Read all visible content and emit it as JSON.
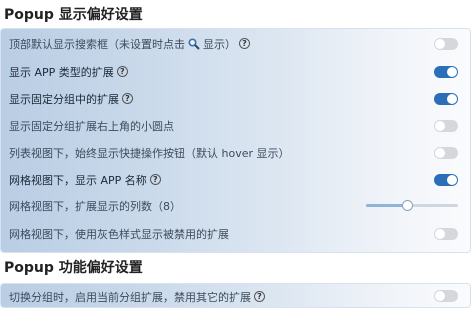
{
  "sections": [
    {
      "title": "Popup 显示偏好设置"
    },
    {
      "title": "Popup 功能偏好设置"
    }
  ],
  "display_prefs": [
    {
      "label": "顶部默认显示搜索框（未设置时点击",
      "label_after": "显示）",
      "icon": "search-icon",
      "help": true,
      "control": "toggle",
      "value": false
    },
    {
      "label": "显示 APP 类型的扩展",
      "help": true,
      "control": "toggle",
      "value": true
    },
    {
      "label": "显示固定分组中的扩展",
      "help": true,
      "control": "toggle",
      "value": true
    },
    {
      "label": "显示固定分组扩展右上角的小圆点",
      "help": false,
      "control": "toggle",
      "value": false
    },
    {
      "label": "列表视图下，始终显示快捷操作按钮（默认 hover 显示）",
      "help": false,
      "control": "toggle",
      "value": false
    },
    {
      "label": "网格视图下，显示 APP 名称",
      "help": true,
      "control": "toggle",
      "value": true
    },
    {
      "label": "网格视图下，扩展显示的列数（8）",
      "help": false,
      "control": "slider",
      "value": 0.45
    },
    {
      "label": "网格视图下，使用灰色样式显示被禁用的扩展",
      "help": false,
      "control": "toggle",
      "value": false
    }
  ],
  "function_prefs": [
    {
      "label": "切换分组时，启用当前分组扩展，禁用其它的扩展",
      "help": true,
      "control": "toggle",
      "value": false
    }
  ],
  "help_glyph": "?",
  "colors": {
    "toggle_on": "#2b6fb8",
    "toggle_off": "#d4d7dc",
    "panel_start": "#b9cde4",
    "panel_end": "#fafbfd"
  }
}
